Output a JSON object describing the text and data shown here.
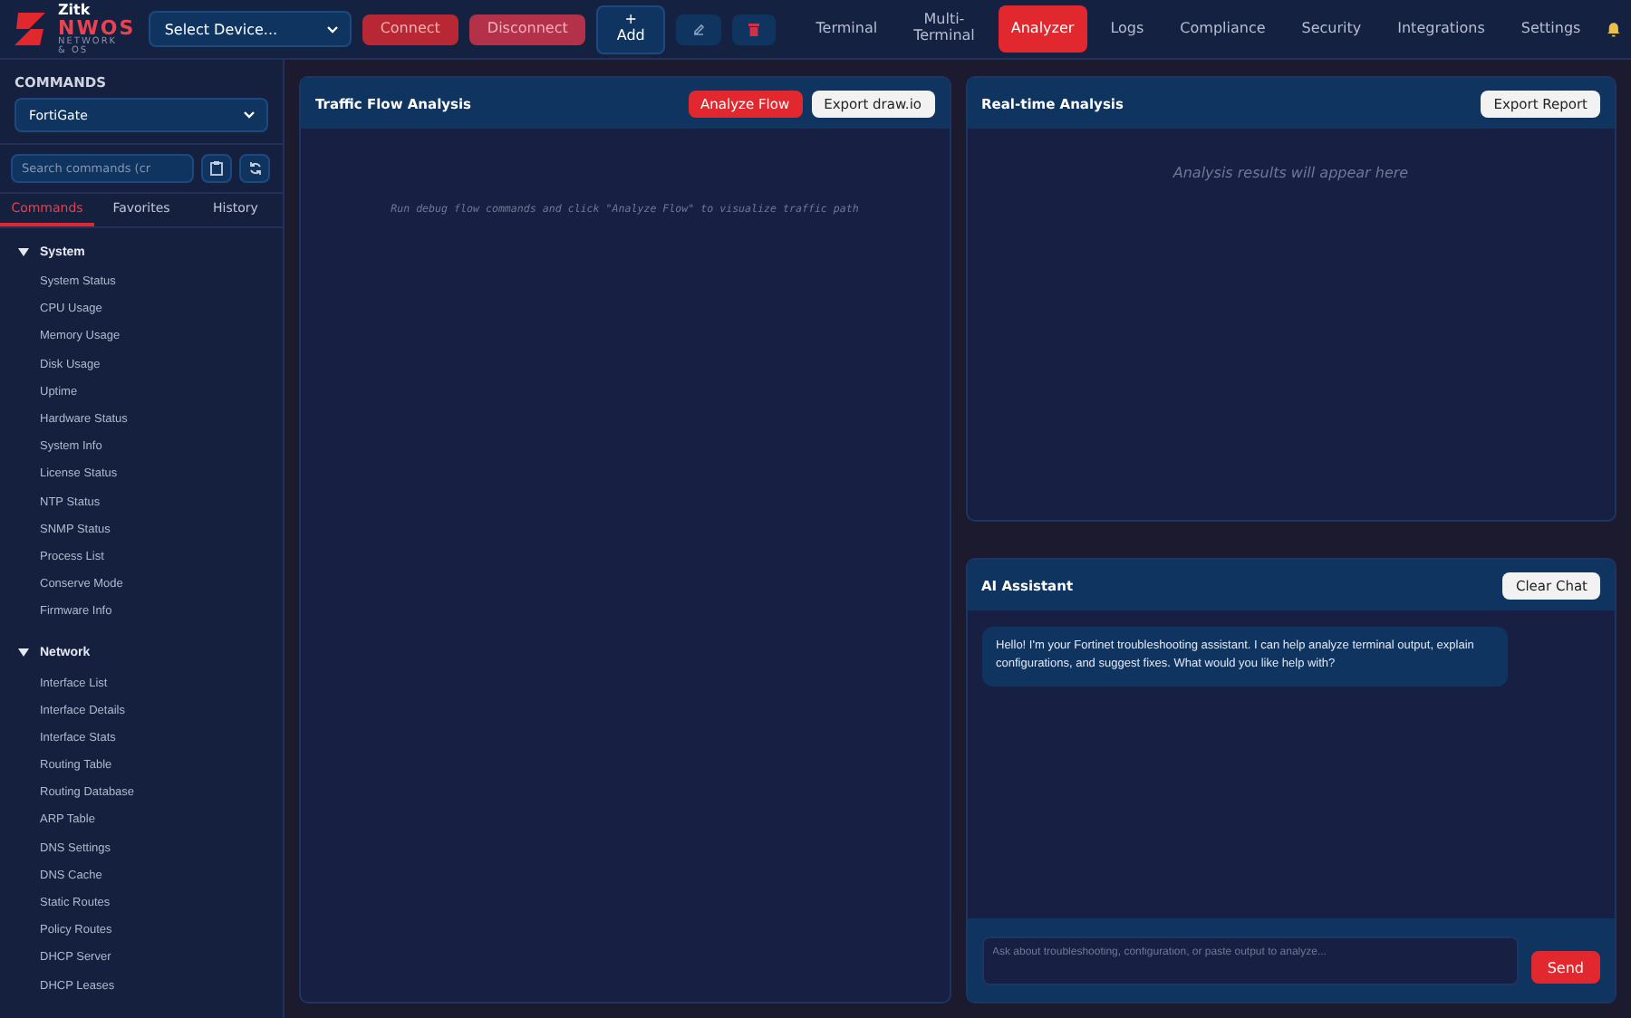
{
  "logo": {
    "title": "Zitk",
    "name": "NWOS",
    "tagline": "NETWORK & OS"
  },
  "device_select": {
    "value": "Select Device..."
  },
  "header_buttons": [
    {
      "label": "Connect",
      "kind": "connect"
    },
    {
      "label": "Disconnect",
      "kind": "disconnect"
    },
    {
      "label": "+\nAdd",
      "kind": "add"
    },
    {
      "kind": "edit"
    },
    {
      "kind": "delete"
    }
  ],
  "nav_tabs": [
    {
      "label": "Terminal",
      "selected": false
    },
    {
      "label": "Multi-\nTerminal",
      "selected": false
    },
    {
      "label": "Analyzer",
      "selected": true
    },
    {
      "label": "Logs",
      "selected": false
    },
    {
      "label": "Compliance",
      "selected": false
    },
    {
      "label": "Security",
      "selected": false
    },
    {
      "label": "Integrations",
      "selected": false
    },
    {
      "label": "Settings",
      "selected": false
    }
  ],
  "sidebar": {
    "title": "COMMANDS",
    "vendor_select": {
      "value": "FortiGate"
    },
    "search": {
      "placeholder": "Search commands (cr"
    },
    "tabs": [
      {
        "label": "Commands",
        "selected": true
      },
      {
        "label": "Favorites",
        "selected": false
      },
      {
        "label": "History",
        "selected": false
      }
    ],
    "groups": [
      {
        "label": "System",
        "expanded": true,
        "children": [
          "System Status",
          "CPU Usage",
          "Memory Usage",
          "Disk Usage",
          "Uptime",
          "Hardware Status",
          "System Info",
          "License Status",
          "NTP Status",
          "SNMP Status",
          "Process List",
          "Conserve Mode",
          "Firmware Info"
        ]
      },
      {
        "label": "Network",
        "expanded": true,
        "children": [
          "Interface List",
          "Interface Details",
          "Interface Stats",
          "Routing Table",
          "Routing Database",
          "ARP Table",
          "DNS Settings",
          "DNS Cache",
          "Static Routes",
          "Policy Routes",
          "DHCP Server",
          "DHCP Leases"
        ]
      }
    ]
  },
  "traffic_panel": {
    "title": "Traffic Flow Analysis",
    "buttons": [
      {
        "label": "Analyze Flow",
        "kind": "primary"
      },
      {
        "label": "Export draw.io",
        "kind": "light"
      }
    ],
    "empty_text": "Run debug flow commands and click \"Analyze Flow\" to visualize traffic path"
  },
  "realtime_panel": {
    "title": "Real-time Analysis",
    "buttons": [
      {
        "label": "Export Report",
        "kind": "light"
      }
    ],
    "empty_text": "Analysis results will appear here"
  },
  "ai_panel": {
    "title": "AI Assistant",
    "buttons": [
      {
        "label": "Clear Chat",
        "kind": "light"
      }
    ],
    "messages": [
      "Hello! I'm your Fortinet troubleshooting assistant. I can help analyze terminal output, explain configurations, and suggest fixes. What would you like help with?"
    ],
    "input": {
      "placeholder": "Ask about troubleshooting, configuration, or paste output to analyze..."
    },
    "send": "Send"
  }
}
